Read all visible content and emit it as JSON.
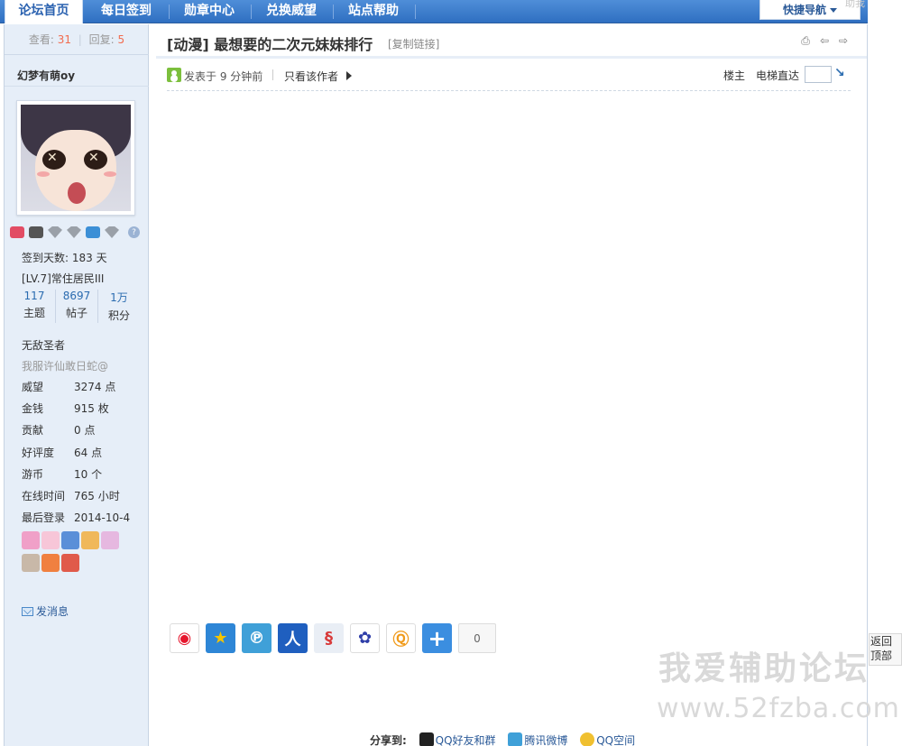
{
  "nav": {
    "tabs": [
      {
        "label": "论坛首页",
        "active": true
      },
      {
        "label": "每日签到"
      },
      {
        "label": "勋章中心"
      },
      {
        "label": "兑换威望"
      },
      {
        "label": "站点帮助"
      }
    ],
    "quick_nav": "快捷导航",
    "corner_ghost": "助我"
  },
  "stats": {
    "views_label": "查看:",
    "views": "31",
    "replies_label": "回复:",
    "replies": "5"
  },
  "thread": {
    "category": "[动漫]",
    "title": "最想要的二次元妹妹排行",
    "copy_link": "[复制链接]"
  },
  "user": {
    "name": "幻梦有萌oy",
    "signin_days": "签到天数: 183 天",
    "level": "[LV.7]常住居民III",
    "counts": [
      {
        "value": "117",
        "label": "主题"
      },
      {
        "value": "8697",
        "label": "帖子"
      },
      {
        "value": "1万",
        "label": "积分"
      }
    ],
    "custom_title": "无敌圣者",
    "signature": "我服许仙敢日蛇@",
    "fields": [
      {
        "key": "威望",
        "value": "3274 点"
      },
      {
        "key": "金钱",
        "value": "915 枚"
      },
      {
        "key": "贡献",
        "value": "0 点"
      },
      {
        "key": "好评度",
        "value": "64 点"
      },
      {
        "key": "游币",
        "value": "10 个"
      },
      {
        "key": "在线时间",
        "value": "765 小时"
      },
      {
        "key": "最后登录",
        "value": "2014-10-4"
      }
    ],
    "send_message": "发消息"
  },
  "post": {
    "posted": "发表于 9 分钟前",
    "only_author": "只看该作者",
    "floor": "楼主",
    "elevator": "电梯直达"
  },
  "share": {
    "count": "0",
    "bottom_label": "分享到:",
    "qq_friends": "QQ好友和群",
    "tencent_weibo": "腾讯微博",
    "qzone": "QQ空间"
  },
  "back_to_top": "返回顶部",
  "watermark": {
    "line1": "我爱辅助论坛",
    "line2": "www.52fzba.com"
  },
  "colors": {
    "nav_blue": "#2f6fc1",
    "sidebar_bg": "#e6eef8",
    "accent_red": "#f26c4f",
    "link_blue": "#2b5a98"
  }
}
